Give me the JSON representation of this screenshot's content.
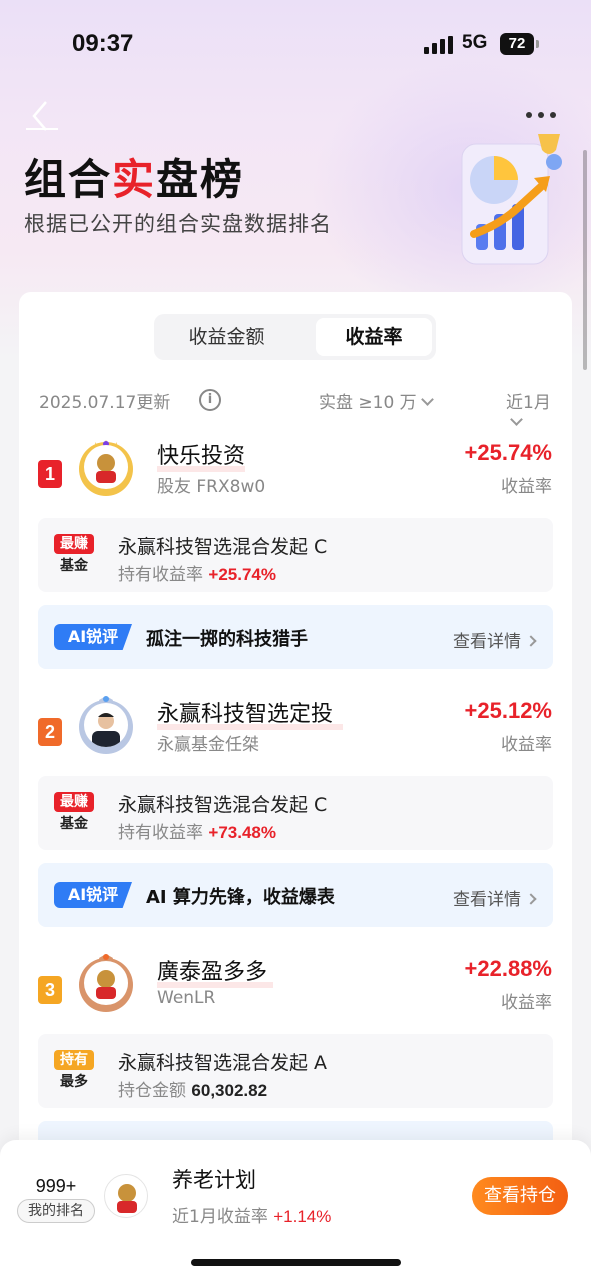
{
  "status_bar": {
    "time": "09:37",
    "network": "5G",
    "battery": "72"
  },
  "header": {
    "title_part1": "组合",
    "title_highlight": "实",
    "title_part2": "盘榜",
    "subtitle": "根据已公开的组合实盘数据排名"
  },
  "tabs": {
    "amount": "收益金额",
    "rate": "收益率",
    "selected": "收益率"
  },
  "filters": {
    "update_date": "2025.07.17更新",
    "info_icon": "i",
    "scale_filter": "实盘 ≥10 万",
    "period_filter": "近1月"
  },
  "rankings": [
    {
      "rank": "1",
      "name": "快乐投资",
      "owner": "股友 FRX8w0",
      "rate": "+25.74%",
      "rate_label": "收益率",
      "rank_color": "#e8222a",
      "fund": {
        "tag_top": "最赚",
        "tag_bottom": "基金",
        "tag_color": "#e8222a",
        "name": "永赢科技智选混合发起 C",
        "metric_label": "持有收益率",
        "metric_value": "+25.74%"
      },
      "ai": {
        "badge": "AI锐评",
        "text": "孤注一掷的科技猎手",
        "detail": "查看详情"
      }
    },
    {
      "rank": "2",
      "name": "永赢科技智选定投",
      "owner": "永赢基金任桀",
      "rate": "+25.12%",
      "rate_label": "收益率",
      "rank_color": "#f06a2a",
      "fund": {
        "tag_top": "最赚",
        "tag_bottom": "基金",
        "tag_color": "#e8222a",
        "name": "永赢科技智选混合发起 C",
        "metric_label": "持有收益率",
        "metric_value": "+73.48%"
      },
      "ai": {
        "badge": "AI锐评",
        "text": "AI 算力先锋，收益爆表",
        "detail": "查看详情"
      }
    },
    {
      "rank": "3",
      "name": "廣泰盈多多",
      "owner": "WenLR",
      "rate": "+22.88%",
      "rate_label": "收益率",
      "rank_color": "#f5a623",
      "fund": {
        "tag_top": "持有",
        "tag_bottom": "最多",
        "tag_color": "#f5a623",
        "name": "永赢科技智选混合发起 A",
        "metric_label": "持仓金额",
        "metric_value": "60,302.82"
      }
    }
  ],
  "my_entry": {
    "rank": "999+",
    "rank_label": "我的排名",
    "name": "养老计划",
    "sub_label": "近1月收益率",
    "sub_value": "+1.14%",
    "button": "查看持仓"
  }
}
